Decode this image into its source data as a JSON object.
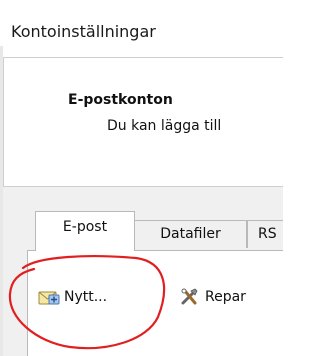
{
  "window": {
    "title": "Kontoinställningar"
  },
  "header": {
    "title": "E-postkonton",
    "description": "Du kan lägga till"
  },
  "tabs": [
    {
      "label": "E-post",
      "active": true
    },
    {
      "label": "Datafiler",
      "active": false
    },
    {
      "label": "RS",
      "active": false
    }
  ],
  "toolbar": {
    "new_label": "Nytt...",
    "new_icon": "new-account-envelope-icon",
    "repair_label": "Repar",
    "repair_icon": "repair-tools-icon"
  },
  "annotation": {
    "color": "#e02020",
    "shape": "hand-drawn circle around new button"
  }
}
